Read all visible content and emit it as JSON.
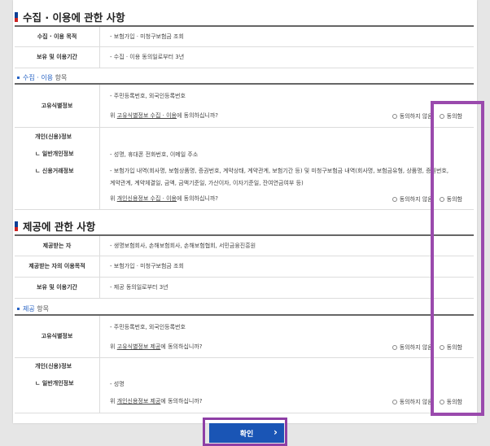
{
  "collection": {
    "title": "수집 · 이용에 관한 사항",
    "rows": [
      {
        "label": "수집 · 이용 목적",
        "value": "- 보험가입 · 미청구보험금 조회"
      },
      {
        "label": "보유 및 이용기간",
        "value": "- 수집 · 이용 동의일로부터 3년"
      }
    ],
    "items_title_blue": "수집 · 이용",
    "items_title_rest": " 항목",
    "unique_id": {
      "label": "고유식별정보",
      "value": "- 주민등록번호, 외국인등록번호",
      "q_pre": "위 ",
      "q_link": "고유식별정보 수집 · 이용",
      "q_post": "에 동의하십니까?",
      "disagree": "동의하지 않음",
      "agree": "동의함"
    },
    "personal": {
      "label1": "개인(신용)정보",
      "label2": "ㄴ 일반개인정보",
      "label3": "ㄴ 신용거래정보",
      "general": "- 성명, 휴대폰 전화번호, 이메일 주소",
      "credit1": "- 보험가입 내역(회사명, 보험상품명, 증권번호, 계약상태, 계약관계, 보험기간 등) 및 미청구보험금 내역(회사명, 보험금유형, 상품명, 증권번호,",
      "credit2": "계약관계, 계약체결일, 금액, 금액기준일, 가산이자, 이자기준일, 잔여연금여부 등)",
      "q_pre": "위 ",
      "q_link": "개인신용정보 수집 · 이용",
      "q_post": "에 동의하십니까?",
      "disagree": "동의하지 않음",
      "agree": "동의함"
    }
  },
  "provision": {
    "title": "제공에 관한 사항",
    "rows": [
      {
        "label": "제공받는 자",
        "value": "- 생명보험회사, 손해보험회사, 손해보험협회, 서민금융진흥원"
      },
      {
        "label": "제공받는 자의 이용목적",
        "value": "- 보험가입 · 미청구보험금 조회"
      },
      {
        "label": "보유 및 이용기간",
        "value": "- 제공 동의일로부터 3년"
      }
    ],
    "items_title_blue": "제공",
    "items_title_rest": " 항목",
    "unique_id": {
      "label": "고유식별정보",
      "value": "- 주민등록번호, 외국인등록번호",
      "q_pre": "위 ",
      "q_link": "고유식별정보 제공",
      "q_post": "에 동의하십니까?",
      "disagree": "동의하지 않음",
      "agree": "동의함"
    },
    "personal": {
      "label1": "개인(신용)정보",
      "label2": "ㄴ 일반개인정보",
      "general": "- 성명",
      "q_pre": "위 ",
      "q_link": "개인신용정보 제공",
      "q_post": "에 동의하십니까?",
      "disagree": "동의하지 않음",
      "agree": "동의함"
    }
  },
  "confirm_label": "확인",
  "colors": {
    "accent": "#1a55b5",
    "highlight": "#9a4aad",
    "link_blue": "#2763c4"
  }
}
